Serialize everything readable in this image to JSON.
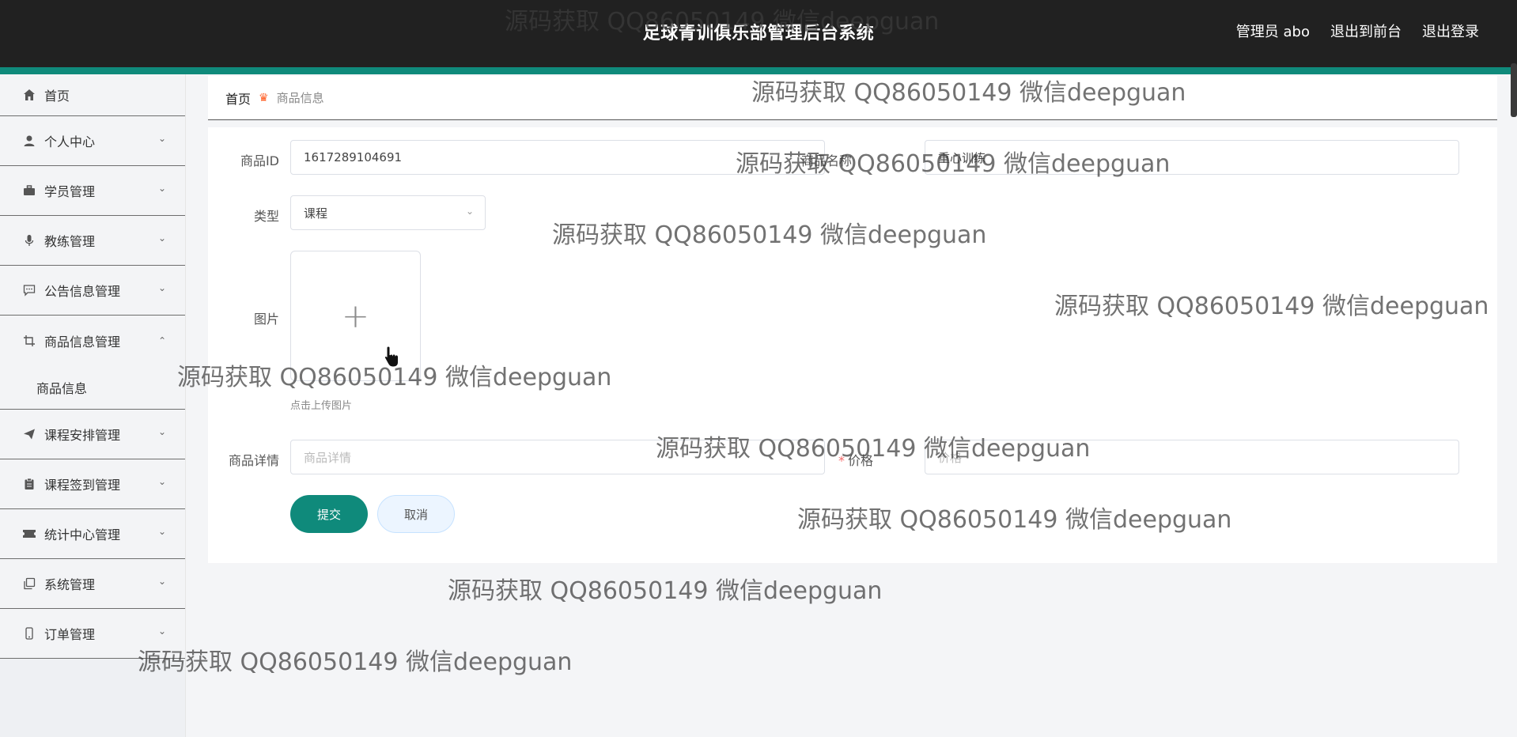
{
  "header": {
    "title": "足球青训俱乐部管理后台系统",
    "admin": "管理员 abo",
    "to_front": "退出到前台",
    "logout": "退出登录"
  },
  "sidebar": {
    "items": [
      {
        "label": "首页",
        "icon": "home-icon"
      },
      {
        "label": "个人中心",
        "icon": "user-icon"
      },
      {
        "label": "学员管理",
        "icon": "briefcase-icon"
      },
      {
        "label": "教练管理",
        "icon": "microphone-icon"
      },
      {
        "label": "公告信息管理",
        "icon": "chat-icon"
      },
      {
        "label": "商品信息管理",
        "icon": "crop-icon",
        "expanded": true
      },
      {
        "label": "课程安排管理",
        "icon": "send-icon"
      },
      {
        "label": "课程签到管理",
        "icon": "clipboard-icon"
      },
      {
        "label": "统计中心管理",
        "icon": "ticket-icon"
      },
      {
        "label": "系统管理",
        "icon": "copy-icon"
      },
      {
        "label": "订单管理",
        "icon": "phone-icon"
      }
    ],
    "submenu": {
      "label": "商品信息"
    }
  },
  "breadcrumb": {
    "home": "首页",
    "current": "商品信息"
  },
  "form": {
    "id_label": "商品ID",
    "id_value": "1617289104691",
    "name_label": "商品名称",
    "name_value": "重心训练",
    "type_label": "类型",
    "type_value": "课程",
    "image_label": "图片",
    "upload_hint": "点击上传图片",
    "detail_label": "商品详情",
    "detail_placeholder": "商品详情",
    "price_label": "价格",
    "price_placeholder": "价格",
    "submit": "提交",
    "cancel": "取消"
  },
  "watermark": "源码获取 QQ86050149 微信deepguan",
  "colors": {
    "header_bg": "#212121",
    "accent": "#0f8a7b",
    "crumb_separator": "#ff5a1f",
    "required": "#f56c6c"
  }
}
